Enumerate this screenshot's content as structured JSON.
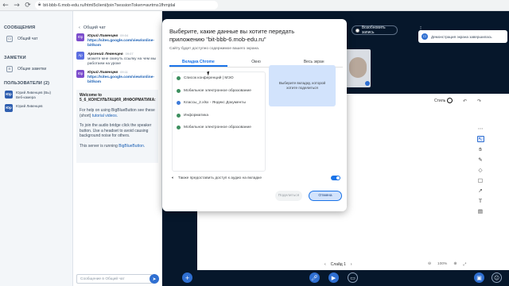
{
  "browser": {
    "url": "bit-bbb-6.mob-edu.ru/html5client/join?sessionToken=avrtms1fhmjdal"
  },
  "sidebar": {
    "messages_title": "СООБЩЕНИЯ",
    "public_chat": "Общий чат",
    "notes_title": "ЗАМЕТКИ",
    "shared_notes": "Общие заметки",
    "users_title": "ПОЛЬЗОВАТЕЛИ (2)",
    "users": [
      {
        "initials": "Юр",
        "name": "Юрий Ливенцев (Вы)",
        "note": "Веб-камера"
      },
      {
        "initials": "Юр",
        "name": "Юрий Ливенцев",
        "note": ""
      }
    ]
  },
  "chat": {
    "title": "Общий чат",
    "messages": [
      {
        "initials": "Юр",
        "name": "Юрий Ливенцев",
        "time": "09:04",
        "text": "https://sites.google.com/view/online-bit/kom"
      },
      {
        "initials": "Ар",
        "name": "Арсений Левенцев",
        "time": "09:07",
        "text": "можете мне скинуть ссылку на чем мы работаем на уроке"
      },
      {
        "initials": "Юр",
        "name": "Юрий Ливенцев",
        "time": "09:11",
        "text": "https://sites.google.com/view/online-bit/kom"
      }
    ],
    "welcome_line1": "Welcome to",
    "welcome_line2": "5_6_КОНСУЛЬТАЦИЯ_ИНФОРМАТИКА:",
    "welcome_help": "For help on using BigBlueButton see these (short)",
    "welcome_help_link": "tutorial videos.",
    "welcome_audio": "To join the audio bridge click the speaker button. Use a headset to avoid causing background noise for others.",
    "welcome_running": "This server is running",
    "welcome_running_link": "BigBlueButton.",
    "input_placeholder": "Сообщение в Общий чат"
  },
  "stage": {
    "record_label": "Возобновить запись",
    "toast": "Демонстрация экрана завершилась",
    "style_label": "Стиль",
    "slide_label": "Слайд 1",
    "zoom": "100%"
  },
  "modal": {
    "title": "Выберите, какие данные вы хотите передать приложению \"bit-bbb-6.mob-edu.ru\"",
    "subtitle": "Сайту будет доступно содержимое вашего экрана.",
    "tabs": [
      "Вкладка Chrome",
      "Окно",
      "Весь экран"
    ],
    "active_tab": "Вкладка Chrome",
    "tab_items": [
      {
        "label": "Список конференций | МЭО",
        "color": "#3d8f5f"
      },
      {
        "label": "Мобильное электронное образование",
        "color": "#3d8f5f"
      },
      {
        "label": "Классы_2.xlsx - Яндекс Документы",
        "color": "#3c7ad9"
      },
      {
        "label": "Информатика",
        "color": "#3d8f5f"
      },
      {
        "label": "Мобильное электронное образование",
        "color": "#3d8f5f"
      }
    ],
    "preview_text": "Выберите вкладку, которой хотите поделиться",
    "audio_label": "Также предоставить доступ к аудио на вкладке",
    "audio_enabled": true,
    "share_button": "Поделиться",
    "cancel_button": "Отмена"
  }
}
